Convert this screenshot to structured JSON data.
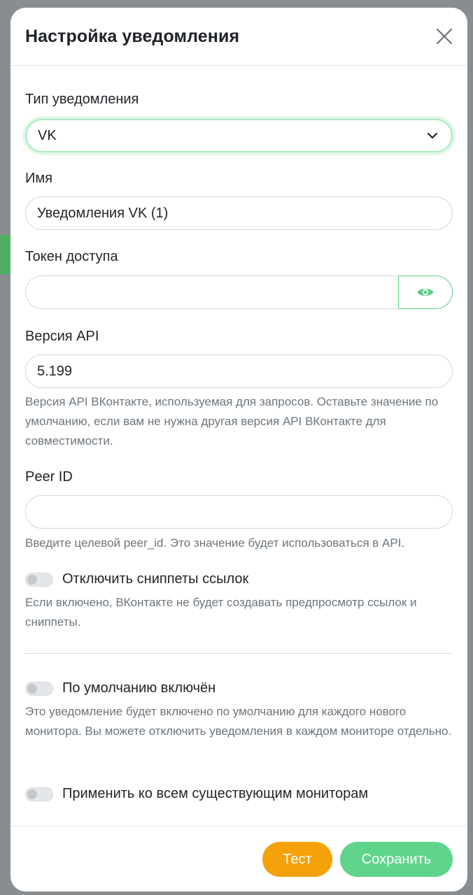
{
  "modal": {
    "title": "Настройка уведомления"
  },
  "fields": {
    "notification_type": {
      "label": "Тип уведомления",
      "value": "VK"
    },
    "name": {
      "label": "Имя",
      "value": "Уведомления VK (1)"
    },
    "token": {
      "label": "Токен доступа",
      "value": ""
    },
    "api_version": {
      "label": "Версия API",
      "value": "5.199",
      "hint": "Версия API ВКонтакте, используемая для запросов. Оставьте значение по умолчанию, если вам не нужна другая версия API ВКонтакте для совместимости."
    },
    "peer_id": {
      "label": "Peer ID",
      "value": "",
      "hint": "Введите целевой peer_id. Это значение будет использоваться в API."
    }
  },
  "toggles": {
    "disable_snippets": {
      "label": "Отключить сниппеты ссылок",
      "hint": "Если включено, ВКонтакте не будет создавать предпросмотр ссылок и сниппеты.",
      "checked": false
    },
    "default_enabled": {
      "label": "По умолчанию включён",
      "hint": "Это уведомление будет включено по умолчанию для каждого нового монитора. Вы можете отключить уведомления в каждом мониторе отдельно.",
      "checked": false
    },
    "apply_existing": {
      "label": "Применить ко всем существующим мониторам",
      "checked": false
    }
  },
  "footer": {
    "test_label": "Тест",
    "save_label": "Сохранить"
  },
  "colors": {
    "accent_green": "#5fd48b",
    "test_orange": "#f5a10a"
  },
  "icons": {
    "close": "close-icon",
    "chevron": "chevron-down-icon",
    "eye": "eye-icon"
  }
}
